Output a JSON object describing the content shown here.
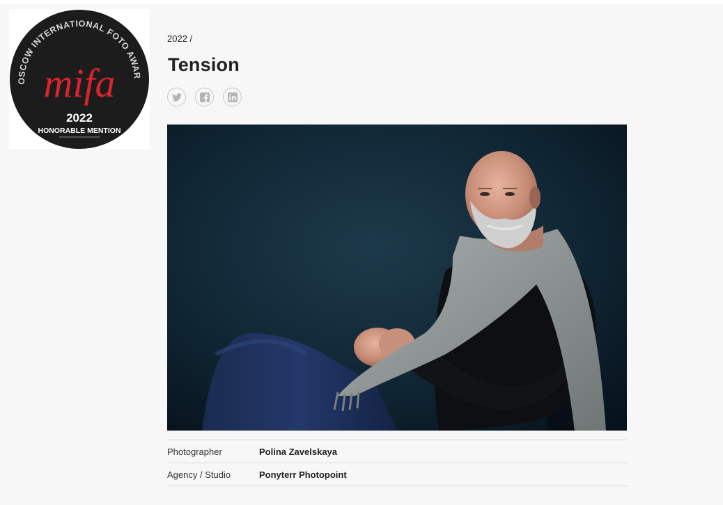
{
  "badge": {
    "arc_text": "MOSCOW INTERNATIONAL FOTO AWARDS",
    "logo_text": "mifa",
    "year": "2022",
    "award": "HONORABLE MENTION"
  },
  "breadcrumb": {
    "year": "2022",
    "separator": "/"
  },
  "entry": {
    "title": "Tension"
  },
  "social": [
    {
      "icon": "twitter-icon"
    },
    {
      "icon": "facebook-icon"
    },
    {
      "icon": "linkedin-icon"
    }
  ],
  "photo": {
    "subject": "portrait-photo"
  },
  "info": [
    {
      "label": "Photographer",
      "value": "Polina Zavelskaya"
    },
    {
      "label": "Agency / Studio",
      "value": "Ponyterr Photopoint"
    }
  ],
  "colors": {
    "logo_red": "#d9232e",
    "badge_bg": "#1c1c1c",
    "page_bg": "#f7f7f7"
  }
}
